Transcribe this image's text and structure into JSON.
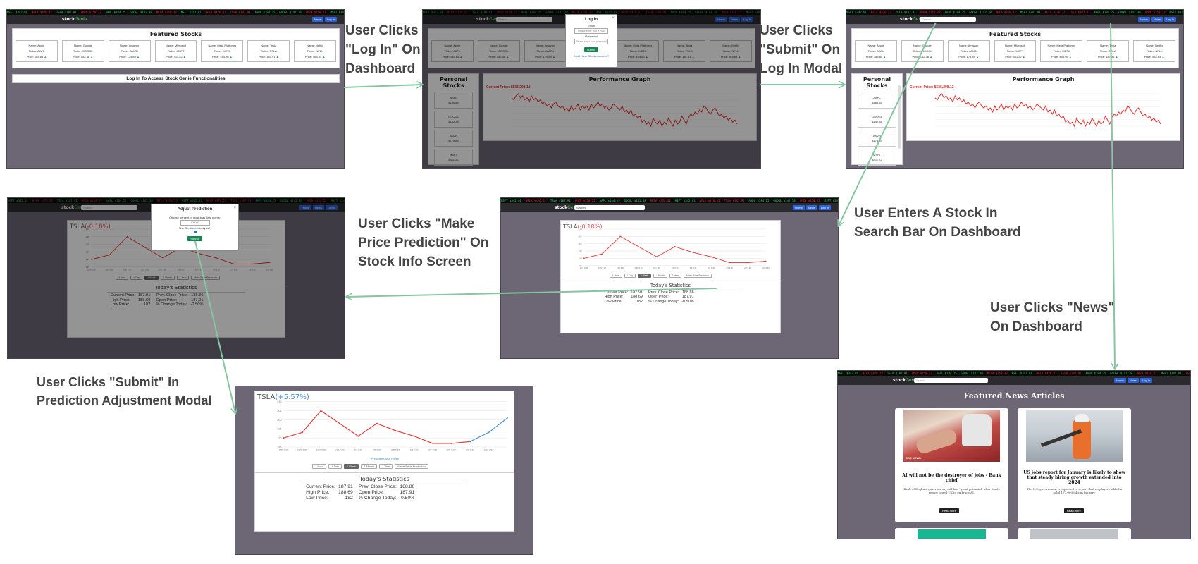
{
  "colors": {
    "arrow": "#85c6a0",
    "loss": "#e05353",
    "gain": "#3d8fe0",
    "gain_green": "#2aa84a",
    "panel_bg": "#6d6775"
  },
  "labels": [
    {
      "lines": [
        "User Clicks",
        "\"Log In\" On",
        "Dashboard"
      ]
    },
    {
      "lines": [
        "User Clicks",
        "\"Submit\" On",
        "Log In Modal"
      ]
    },
    {
      "lines": [
        "User Enters A Stock In",
        "Search Bar On Dashboard"
      ]
    },
    {
      "lines": [
        "User Clicks \"Make",
        "Price Prediction\" On",
        "Stock Info Screen"
      ]
    },
    {
      "lines": [
        "User Clicks \"News\"",
        "On Dashboard"
      ]
    },
    {
      "lines": [
        "User Clicks \"Submit\" In",
        "Prediction Adjustment Modal"
      ]
    }
  ],
  "app": {
    "brand_left": "stock",
    "brand_right": "Genie",
    "search_placeholder": "Search",
    "nav": [
      "Home",
      "News",
      "Log In"
    ],
    "ticker": [
      {
        "t": "MSFT $342.01",
        "c": "#2cd34d"
      },
      {
        "t": "NFLX $476.22",
        "c": "#e52828"
      },
      {
        "t": "TSLA $187.91",
        "c": "#2cd34d"
      },
      {
        "t": "AMZN $150.22",
        "c": "#e52828"
      },
      {
        "t": "AAPL $184.25",
        "c": "#2cd34d"
      },
      {
        "t": "GOOGL $142.38",
        "c": "#2cd34d"
      },
      {
        "t": "META $358.32",
        "c": "#e52828"
      },
      {
        "t": "MSFT $342.01",
        "c": "#2cd34d"
      },
      {
        "t": "NFLX $476.22",
        "c": "#e52828"
      },
      {
        "t": "TSLA $187.91",
        "c": "#e52828"
      },
      {
        "t": "AAPL $184.25",
        "c": "#2cd34d"
      },
      {
        "t": "GOOGL $142.38",
        "c": "#2cd34d"
      },
      {
        "t": "AMZN $150.22",
        "c": "#e52828"
      },
      {
        "t": "MSFT $342.01",
        "c": "#2cd34d"
      },
      {
        "t": "TSLA $187.91",
        "c": "#e52828"
      }
    ],
    "featured_title": "Featured Stocks",
    "featured": [
      {
        "name": "Name: Apple",
        "ticker": "Ticker: AAPL",
        "price": "Price: 185.85"
      },
      {
        "name": "Name: Google",
        "ticker": "Ticker: GOOGL",
        "price": "Price: 142.38"
      },
      {
        "name": "Name: Amazon",
        "ticker": "Ticker: AMZN",
        "price": "Price: 175.89"
      },
      {
        "name": "Name: Microsoft",
        "ticker": "Ticker: MSFT",
        "price": "Price: 411.22"
      },
      {
        "name": "Name: Meta Platforms",
        "ticker": "Ticker: META",
        "price": "Price: 454.96"
      },
      {
        "name": "Name: Tesla",
        "ticker": "Ticker: TSLA",
        "price": "Price: 187.91"
      },
      {
        "name": "Name: Netflix",
        "ticker": "Ticker: NFLX",
        "price": "Price: 564.64"
      }
    ],
    "login_bar": "Log In To Access Stock Genie Functionalities",
    "login_modal": {
      "title": "Log In",
      "email_label": "Email",
      "email_ph": "Please enter your e-mail",
      "password_label": "Password",
      "password_ph": "Please enter your password",
      "submit": "Submit",
      "forgot": "Don't Have Stocks Account?"
    },
    "personal_title": "Personal Stocks",
    "personal": [
      {
        "t": "AAPL",
        "p": "$185.85"
      },
      {
        "t": "GOOGL",
        "p": "$142.38"
      },
      {
        "t": "AMZN",
        "p": "$175.89"
      },
      {
        "t": "MSFT",
        "p": "$411.22"
      }
    ],
    "perf_title": "Performance Graph",
    "current_price": "Current Price: $535,298.12",
    "perf_series": [
      22,
      21,
      23,
      24,
      22,
      23,
      21,
      22,
      20,
      23,
      21,
      22,
      20,
      21,
      19,
      20,
      18,
      19,
      17,
      19,
      20,
      18,
      17,
      18,
      16,
      17,
      15,
      18,
      16,
      17,
      19,
      16,
      18,
      17,
      18,
      16,
      19,
      17,
      18,
      20,
      18,
      19,
      17,
      18,
      16,
      17,
      19,
      18,
      17,
      16,
      18,
      15,
      16,
      14,
      16,
      13,
      14,
      12,
      13,
      10,
      11,
      9,
      10,
      8,
      12,
      10,
      9,
      11,
      8,
      10,
      9,
      12,
      10,
      8,
      11,
      9,
      10,
      13,
      11,
      9,
      12,
      14,
      13,
      15,
      14,
      16,
      15,
      18,
      17,
      15,
      14,
      16,
      17,
      15,
      13,
      14,
      12,
      13,
      11,
      12,
      10,
      11,
      9
    ],
    "detail": {
      "ticker": "TSLA",
      "change": "(-0.18%)",
      "change_pred": "(+5.57%)",
      "periods": [
        "1 Hour",
        "1 Day",
        "1 Week",
        "1 Month",
        "1 Year",
        "Make Price Prediction"
      ],
      "active_period": "1 Week",
      "predicted_label": "*Predicted Close Prices",
      "stats_title": "Today's Statistics",
      "stats": [
        {
          "l1": "Current Price:",
          "v1": "187.91",
          "l2": "Prev. Close Price:",
          "v2": "188.86"
        },
        {
          "l1": "High Price:",
          "v1": "188.69",
          "l2": "Open Price:",
          "v2": "187.91"
        },
        {
          "l1": "Low Price:",
          "v1": "182",
          "l2": "% Change Today:",
          "v2": "-0.50%"
        }
      ]
    },
    "adjust_modal": {
      "title": "Adjust Prediction",
      "line1": "Choose percent of most-bias data points:",
      "input_value": "100000",
      "line2": "Use Sentiment Analysis?",
      "submit": "Submit"
    },
    "news": {
      "title": "Featured News Articles",
      "articles": [
        {
          "headline": "AI will not be the destroyer of jobs - Bank chief",
          "body": "Bank of England governor says AI has \"great potential\" after Lords report urged UK to embrace AI.",
          "button": "Read more",
          "badge": "BBC NEWS"
        },
        {
          "headline": "US jobs report for January is likely to show that steady hiring growth extended into 2024",
          "body": "The U.S. government is expected to report that employers added a solid 177,000 jobs in January.",
          "button": "Read more"
        }
      ]
    }
  },
  "chart_data": {
    "type": "line",
    "title": "TSLA (-0.18%)",
    "x": [
      "1/26 9:30",
      "1/29 9:30",
      "1/30 9:30",
      "1/31 9:30",
      "2/1 9:30",
      "2/2 9:30",
      "2/5 9:30",
      "2/6 9:30",
      "2/7 9:30",
      "2/8 9:30",
      "2/9 9:30"
    ],
    "series": [
      {
        "name": "TSLA",
        "color": "#e53030",
        "values": [
          190,
          193,
          205,
          198,
          191,
          198,
          194,
          191,
          187,
          187,
          188
        ]
      }
    ],
    "prediction": {
      "name": "*Predicted Close Prices",
      "color": "#3d8fe0",
      "x": [
        "2/9 9:30",
        "2/12",
        "2/13"
      ],
      "values": [
        188,
        193,
        201
      ]
    },
    "ylim": [
      185,
      210
    ]
  }
}
